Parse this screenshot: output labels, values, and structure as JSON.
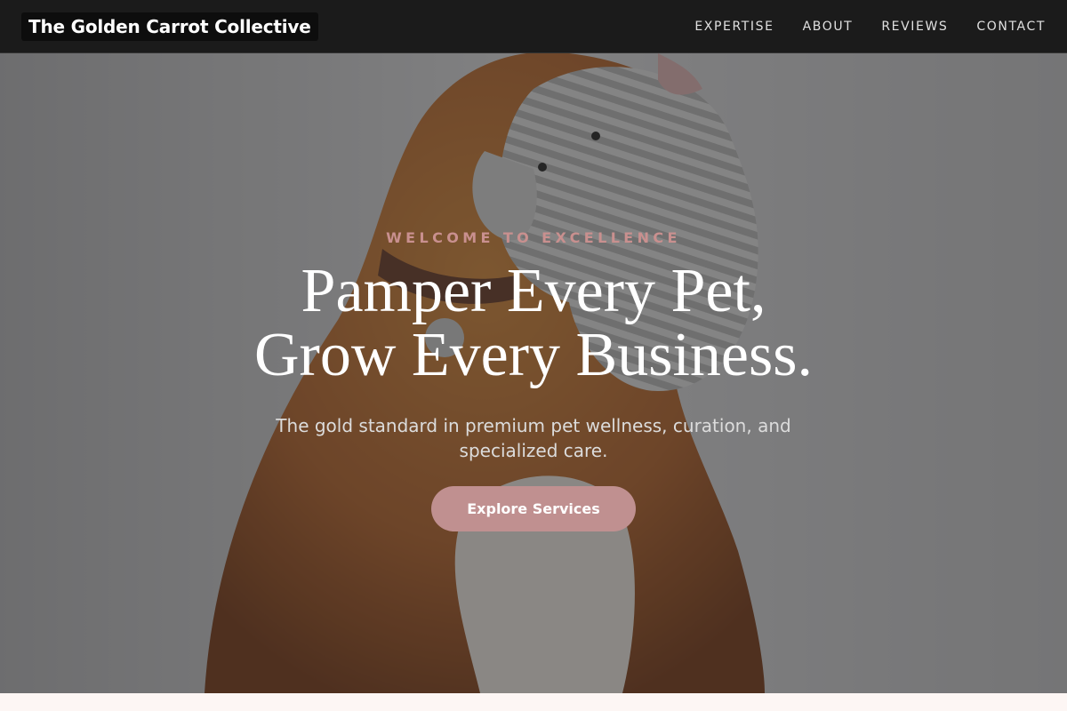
{
  "nav": {
    "brand": "The Golden Carrot Collective",
    "links": [
      "EXPERTISE",
      "ABOUT",
      "REVIEWS",
      "CONTACT"
    ]
  },
  "hero": {
    "eyebrow": "WELCOME TO EXCELLENCE",
    "headline_line1": "Pamper Every Pet,",
    "headline_line2": "Grow Every Business.",
    "subhead": "The gold standard in premium pet wellness, curation, and specialized care.",
    "cta_label": "Explore Services"
  },
  "colors": {
    "nav_bg": "#1b1b1b",
    "accent": "#c09090",
    "eyebrow": "#c9908f",
    "page_bg": "#fdf6f4"
  },
  "icons": {
    "hero_image": "dog-holding-plush-elephant"
  }
}
